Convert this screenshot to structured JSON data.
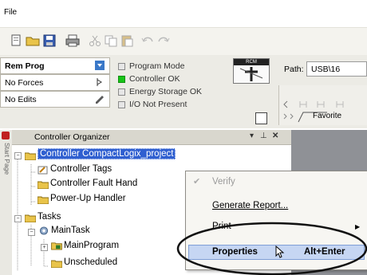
{
  "menubar": {
    "file": "File"
  },
  "status": {
    "mode": "Rem Prog",
    "forces": "No Forces",
    "edits": "No Edits",
    "indicators": [
      {
        "label": "Program Mode",
        "state": "off"
      },
      {
        "label": "Controller OK",
        "state": "on"
      },
      {
        "label": "Energy Storage OK",
        "state": "off"
      },
      {
        "label": "I/O Not Present",
        "state": "off"
      }
    ],
    "keyswitch_label": "RCM",
    "path_label": "Path:",
    "path_value": "USB\\16",
    "favorites": "Favorite"
  },
  "organizer": {
    "title": "Controller Organizer",
    "side_tab": "Start Page",
    "pin": "− p",
    "close": "✕",
    "tree": {
      "controller": "Controller CompactLogix_project",
      "tags": "Controller Tags",
      "fault": "Controller Fault Hand",
      "powerup": "Power-Up Handler",
      "tasks": "Tasks",
      "maintask": "MainTask",
      "mainprogram": "MainProgram",
      "unscheduled": "Unscheduled"
    }
  },
  "context_menu": {
    "verify": "Verify",
    "generate_report": "Generate Report...",
    "print": "Print",
    "properties": "Properties",
    "properties_shortcut": "Alt+Enter"
  },
  "colors": {
    "selection": "#2f5fd0",
    "highlight": "#c6d6f3",
    "controller_ok": "#17c417",
    "annotation": "#000000"
  }
}
